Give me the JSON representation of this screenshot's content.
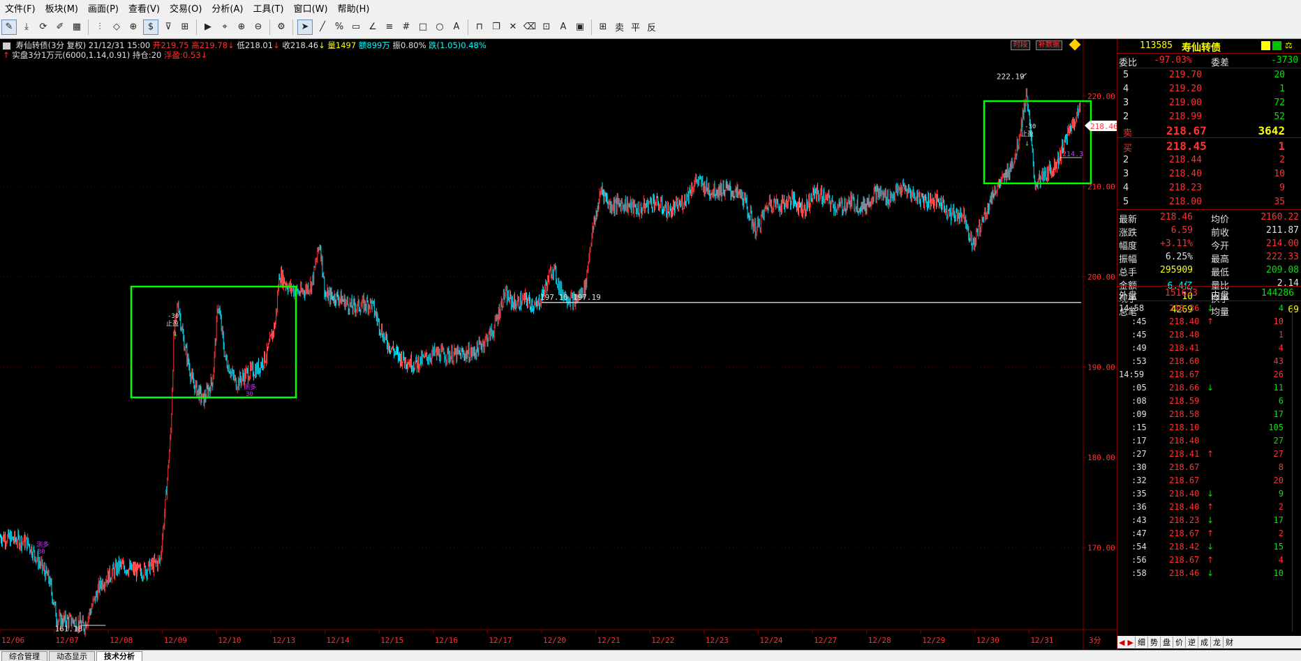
{
  "menu": [
    "文件(F)",
    "板块(M)",
    "画面(P)",
    "查看(V)",
    "交易(O)",
    "分析(A)",
    "工具(T)",
    "窗口(W)",
    "帮助(H)"
  ],
  "toolbar": {
    "period_label": "$",
    "sell_label": "卖",
    "flat_label": "平",
    "reverse_label": "反"
  },
  "chart_info": {
    "name": "寿仙转债",
    "period": "(3分 复权)",
    "datetime": "21/12/31 15:00",
    "open_label": "开",
    "open": "219.75",
    "high_label": "高",
    "high": "219.78",
    "low_label": "低",
    "low": "218.01",
    "close_label": "收",
    "close": "218.46",
    "vol_label": "量",
    "vol": "1497",
    "amount_label": "额",
    "amount": "899万",
    "amp_label": "振",
    "amp": "0.80%",
    "drop_label": "跌",
    "drop": "(1.05)",
    "drop_pct": "0.48%",
    "line2_main": "实盘3分1万元(6000,1.14,0.91)",
    "position_label": "持仓:",
    "position": "20",
    "pnl_label": "浮盈:",
    "pnl": "0.53",
    "btn_timeshare": "时段",
    "btn_data": "补数据"
  },
  "chart_labels": {
    "low_mark": "161.18",
    "high_mark": "222.19",
    "line_left": "197.10",
    "line_right": "197.19",
    "stop1_qty": "-30",
    "stop1": "止盈",
    "buy1": "测多",
    "buy1_qty": "30",
    "buy2": "测多",
    "buy2_qty": "30",
    "stop2_qty": "-30",
    "stop2": "止盈",
    "mini_label": "214.3",
    "current_price_tag": "218.46",
    "period_name": "3分"
  },
  "chart_data": {
    "type": "candlestick",
    "x_ticks": [
      "12/06",
      "12/07",
      "12/08",
      "12/09",
      "12/10",
      "12/13",
      "12/14",
      "12/15",
      "12/16",
      "12/17",
      "12/20",
      "12/21",
      "12/22",
      "12/23",
      "12/24",
      "12/27",
      "12/28",
      "12/29",
      "12/30",
      "12/31"
    ],
    "y_ticks": [
      170,
      180,
      190,
      200,
      210,
      220
    ],
    "y_tick_labels": [
      "170.00",
      "180.00",
      "190.00",
      "200.00",
      "210.00",
      "220.00"
    ],
    "ylim": [
      161,
      224
    ],
    "path": [
      [
        0,
        171.2
      ],
      [
        0.5,
        170.6
      ],
      [
        0.9,
        166.5
      ],
      [
        1.05,
        162.0
      ],
      [
        1.35,
        161.9
      ],
      [
        1.55,
        161.3
      ],
      [
        1.85,
        166.0
      ],
      [
        2.2,
        168.0
      ],
      [
        2.6,
        167.3
      ],
      [
        2.95,
        168.5
      ],
      [
        3.05,
        175
      ],
      [
        3.15,
        183
      ],
      [
        3.2,
        193
      ],
      [
        3.28,
        197.2
      ],
      [
        3.38,
        193
      ],
      [
        3.55,
        188.3
      ],
      [
        3.75,
        186.3
      ],
      [
        3.92,
        188.6
      ],
      [
        4.02,
        197.2
      ],
      [
        4.15,
        191
      ],
      [
        4.35,
        188.2
      ],
      [
        4.55,
        189.3
      ],
      [
        4.75,
        189.8
      ],
      [
        4.92,
        191.4
      ],
      [
        5.08,
        195
      ],
      [
        5.15,
        200.3
      ],
      [
        5.35,
        198.7
      ],
      [
        5.55,
        198.2
      ],
      [
        5.75,
        199.2
      ],
      [
        5.9,
        203.8
      ],
      [
        6.0,
        197.9
      ],
      [
        6.25,
        197.7
      ],
      [
        6.5,
        196.6
      ],
      [
        6.85,
        197.1
      ],
      [
        7.1,
        193.0
      ],
      [
        7.35,
        191.2
      ],
      [
        7.65,
        190.3
      ],
      [
        8.0,
        191.5
      ],
      [
        8.35,
        191.3
      ],
      [
        8.75,
        191.6
      ],
      [
        9.1,
        194.0
      ],
      [
        9.3,
        198.0
      ],
      [
        9.5,
        197.0
      ],
      [
        9.7,
        197.5
      ],
      [
        9.9,
        196.6
      ],
      [
        10.05,
        198.6
      ],
      [
        10.2,
        201.1
      ],
      [
        10.35,
        198.4
      ],
      [
        10.6,
        197.2
      ],
      [
        10.8,
        198.8
      ],
      [
        10.9,
        204.0
      ],
      [
        11.1,
        209.8
      ],
      [
        11.25,
        207.9
      ],
      [
        11.5,
        208.1
      ],
      [
        11.8,
        207.4
      ],
      [
        12.05,
        208.4
      ],
      [
        12.35,
        207.2
      ],
      [
        12.6,
        208.2
      ],
      [
        12.85,
        210.7
      ],
      [
        13.1,
        209.5
      ],
      [
        13.4,
        209.7
      ],
      [
        13.7,
        208.9
      ],
      [
        13.95,
        205.1
      ],
      [
        14.2,
        208.3
      ],
      [
        14.4,
        207.9
      ],
      [
        14.6,
        208.6
      ],
      [
        14.85,
        207.5
      ],
      [
        15.05,
        209.4
      ],
      [
        15.25,
        208.6
      ],
      [
        15.45,
        207.6
      ],
      [
        15.7,
        208.3
      ],
      [
        15.95,
        207.7
      ],
      [
        16.15,
        209.4
      ],
      [
        16.4,
        208.7
      ],
      [
        16.65,
        209.8
      ],
      [
        16.9,
        208.9
      ],
      [
        17.1,
        208.5
      ],
      [
        17.35,
        208.3
      ],
      [
        17.55,
        206.9
      ],
      [
        17.8,
        206.9
      ],
      [
        17.95,
        203.4
      ],
      [
        18.15,
        206.5
      ],
      [
        18.35,
        209.5
      ],
      [
        18.55,
        211.0
      ],
      [
        18.75,
        213.6
      ],
      [
        18.95,
        220.3
      ],
      [
        19.1,
        210.3
      ],
      [
        19.3,
        211.2
      ],
      [
        19.5,
        212.6
      ],
      [
        19.7,
        215.6
      ],
      [
        19.85,
        217.7
      ],
      [
        19.95,
        218.46
      ]
    ],
    "horizontal_line": 197.15
  },
  "quote": {
    "code": "113585",
    "name": "寿仙转债",
    "entrust_ratio_label": "委比",
    "entrust_ratio": "-97.03%",
    "entrust_diff_label": "委差",
    "entrust_diff": "-3730",
    "asks": [
      {
        "n": "5",
        "p": "219.70",
        "v": "20"
      },
      {
        "n": "4",
        "p": "219.20",
        "v": "1"
      },
      {
        "n": "3",
        "p": "219.00",
        "v": "72"
      },
      {
        "n": "2",
        "p": "218.99",
        "v": "52"
      },
      {
        "n": "卖",
        "p": "218.67",
        "v": "3642"
      }
    ],
    "bids": [
      {
        "n": "买",
        "p": "218.45",
        "v": "1"
      },
      {
        "n": "2",
        "p": "218.44",
        "v": "2"
      },
      {
        "n": "3",
        "p": "218.40",
        "v": "10"
      },
      {
        "n": "4",
        "p": "218.23",
        "v": "9"
      },
      {
        "n": "5",
        "p": "218.00",
        "v": "35"
      }
    ],
    "stats": [
      {
        "l1": "最新",
        "v1": "218.46",
        "c1": "red",
        "l2": "均价",
        "v2": "2160.22",
        "c2": "red"
      },
      {
        "l1": "涨跌",
        "v1": "6.59",
        "c1": "red",
        "l2": "前收",
        "v2": "211.87",
        "c2": "white"
      },
      {
        "l1": "幅度",
        "v1": "+3.11%",
        "c1": "red",
        "l2": "今开",
        "v2": "214.00",
        "c2": "red"
      },
      {
        "l1": "振幅",
        "v1": "6.25%",
        "c1": "white",
        "l2": "最高",
        "v2": "222.33",
        "c2": "red"
      },
      {
        "l1": "总手",
        "v1": "295909",
        "c1": "yellow",
        "l2": "最低",
        "v2": "209.08",
        "c2": "green"
      },
      {
        "l1": "金额",
        "v1": "6.4亿",
        "c1": "cyan",
        "l2": "量比",
        "v2": "2.14",
        "c2": "white"
      },
      {
        "l1": "现手",
        "v1": "10",
        "c1": "yellow",
        "l2": "换手",
        "v2": "",
        "c2": "white"
      },
      {
        "l1": "总笔",
        "v1": "4269",
        "c1": "yellow",
        "l2": "均量",
        "v2": "69",
        "c2": "yellow"
      }
    ],
    "outer_label": "外盘",
    "outer": "151623",
    "inner_label": "内盘",
    "inner": "144286",
    "ticks": [
      {
        "t": "14:58",
        "p": "218.36",
        "a": "down",
        "v": "4",
        "vc": "green"
      },
      {
        "t": ":45",
        "p": "218.40",
        "a": "up",
        "v": "10",
        "vc": "red"
      },
      {
        "t": ":45",
        "p": "218.40",
        "a": "",
        "v": "1",
        "vc": "red"
      },
      {
        "t": ":49",
        "p": "218.41",
        "a": "",
        "v": "4",
        "vc": "red"
      },
      {
        "t": ":53",
        "p": "218.60",
        "a": "",
        "v": "43",
        "vc": "red"
      },
      {
        "t": "14:59",
        "p": "218.67",
        "a": "",
        "v": "26",
        "vc": "red"
      },
      {
        "t": ":05",
        "p": "218.66",
        "a": "down",
        "v": "11",
        "vc": "green"
      },
      {
        "t": ":08",
        "p": "218.59",
        "a": "",
        "v": "6",
        "vc": "green"
      },
      {
        "t": ":09",
        "p": "218.58",
        "a": "",
        "v": "17",
        "vc": "green"
      },
      {
        "t": ":15",
        "p": "218.10",
        "a": "",
        "v": "105",
        "vc": "green"
      },
      {
        "t": ":17",
        "p": "218.40",
        "a": "",
        "v": "27",
        "vc": "green"
      },
      {
        "t": ":27",
        "p": "218.41",
        "a": "up",
        "v": "27",
        "vc": "red"
      },
      {
        "t": ":30",
        "p": "218.67",
        "a": "",
        "v": "8",
        "vc": "red"
      },
      {
        "t": ":32",
        "p": "218.67",
        "a": "",
        "v": "20",
        "vc": "red"
      },
      {
        "t": ":35",
        "p": "218.40",
        "a": "down",
        "v": "9",
        "vc": "green"
      },
      {
        "t": ":36",
        "p": "218.40",
        "a": "up",
        "v": "2",
        "vc": "red"
      },
      {
        "t": ":43",
        "p": "218.23",
        "a": "down",
        "v": "17",
        "vc": "green"
      },
      {
        "t": ":47",
        "p": "218.67",
        "a": "up",
        "v": "2",
        "vc": "red"
      },
      {
        "t": ":54",
        "p": "218.42",
        "a": "down",
        "v": "15",
        "vc": "green"
      },
      {
        "t": ":56",
        "p": "218.67",
        "a": "up",
        "v": "4",
        "vc": "red"
      },
      {
        "t": ":58",
        "p": "218.46",
        "a": "down",
        "v": "10",
        "vc": "green"
      }
    ],
    "bottom_tabs": [
      "细",
      "势",
      "盘",
      "价",
      "逆",
      "成",
      "龙",
      "财"
    ]
  },
  "status_tabs": [
    "综合管理",
    "动态显示",
    "技术分析"
  ],
  "colors": {
    "up": "#ff3232",
    "down": "#00ffff",
    "box": "#00ff00",
    "grid": "#8b0000"
  }
}
